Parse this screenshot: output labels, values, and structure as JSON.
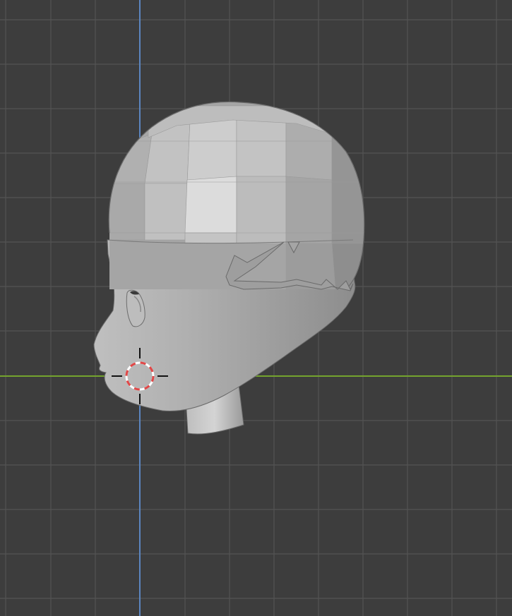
{
  "viewport": {
    "view": "side-orthographic",
    "background_color": "#3d3d3d",
    "grid_color": "#545454",
    "axis_y_color": "#5b86c0",
    "axis_x_color": "#74a32e"
  },
  "object": {
    "kind": "sculpted head mesh",
    "shading": "solid flat gray"
  },
  "cursor": {
    "icon": "3d-cursor-icon",
    "ring_colors": [
      "#e04848",
      "#ffffff"
    ]
  }
}
